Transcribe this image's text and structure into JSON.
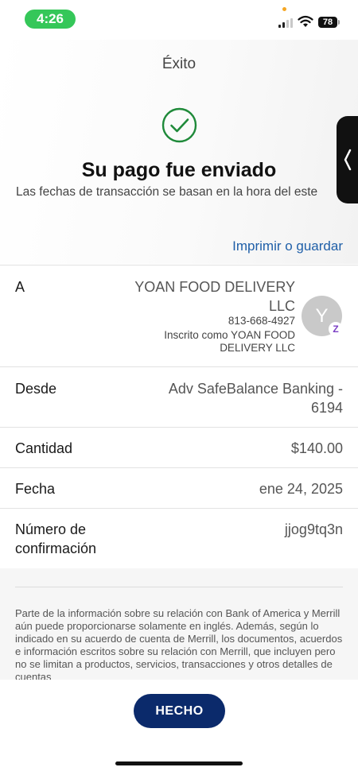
{
  "status_bar": {
    "time": "4:26",
    "battery": "78",
    "accent_color": "#35c759"
  },
  "header": {
    "title": "Éxito",
    "heading": "Su pago fue enviado",
    "subtext": "Las fechas de transacción se basan en la hora del este",
    "print_link": "Imprimir o guardar",
    "link_color": "#1f5fa8"
  },
  "payee": {
    "label": "A",
    "name": "YOAN FOOD DELIVERY LLC",
    "phone": "813-668-4927",
    "enrolled": "Inscrito como YOAN FOOD DELIVERY LLC",
    "avatar_initial": "Y",
    "badge": "Z"
  },
  "details": {
    "from_label": "Desde",
    "from_value": "Adv SafeBalance Banking - 6194",
    "amount_label": "Cantidad",
    "amount_value": "$140.00",
    "date_label": "Fecha",
    "date_value": "ene 24, 2025",
    "confirmation_label": "Número de confirmación",
    "confirmation_value": "jjog9tq3n"
  },
  "disclaimer": "Parte de la información sobre su relación con Bank of America y Merrill aún puede proporcionarse solamente en inglés. Además, según lo indicado en su acuerdo de cuenta de Merrill, los documentos, acuerdos e información escritos sobre su relación con Merrill, que incluyen pero no se limitan a productos, servicios, transacciones y otros detalles de cuentas",
  "footer": {
    "done_label": "HECHO",
    "button_color": "#0b2a6b"
  }
}
